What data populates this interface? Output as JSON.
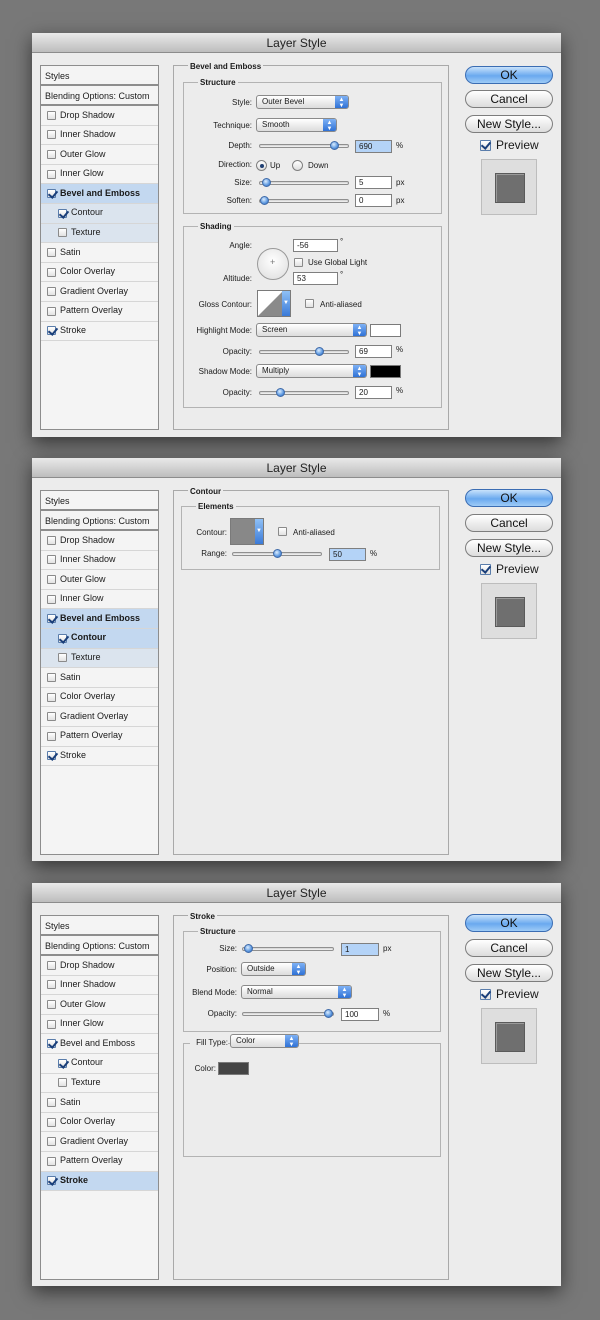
{
  "dialogs": [
    {
      "title": "Layer Style",
      "styles_header": "Styles",
      "blending": "Blending Options: Custom",
      "items": [
        {
          "label": "Drop Shadow",
          "checked": false
        },
        {
          "label": "Inner Shadow",
          "checked": false
        },
        {
          "label": "Outer Glow",
          "checked": false
        },
        {
          "label": "Inner Glow",
          "checked": false
        },
        {
          "label": "Bevel and Emboss",
          "checked": true
        },
        {
          "label": "Contour",
          "checked": true
        },
        {
          "label": "Texture",
          "checked": false
        },
        {
          "label": "Satin",
          "checked": false
        },
        {
          "label": "Color Overlay",
          "checked": false
        },
        {
          "label": "Gradient Overlay",
          "checked": false
        },
        {
          "label": "Pattern Overlay",
          "checked": false
        },
        {
          "label": "Stroke",
          "checked": true
        }
      ],
      "panel_title": "Bevel and Emboss",
      "structure": {
        "title": "Structure",
        "style_label": "Style:",
        "style_value": "Outer Bevel",
        "technique_label": "Technique:",
        "technique_value": "Smooth",
        "depth_label": "Depth:",
        "depth_value": "690",
        "depth_unit": "%",
        "depth_level": 0.88,
        "direction_label": "Direction:",
        "up_label": "Up",
        "down_label": "Down",
        "size_label": "Size:",
        "size_value": "5",
        "size_unit": "px",
        "size_level": 0.03,
        "soften_label": "Soften:",
        "soften_value": "0",
        "soften_unit": "px",
        "soften_level": 0.0
      },
      "shading": {
        "title": "Shading",
        "angle_label": "Angle:",
        "angle_value": "-56",
        "angle_unit": "°",
        "global_light_label": "Use Global Light",
        "altitude_label": "Altitude:",
        "altitude_value": "53",
        "altitude_unit": "°",
        "gloss_label": "Gloss Contour:",
        "anti_aliased_label": "Anti-aliased",
        "highlight_mode_label": "Highlight Mode:",
        "highlight_mode_value": "Screen",
        "highlight_color": "#ffffff",
        "opacity1_label": "Opacity:",
        "opacity1_value": "69",
        "opacity1_unit": "%",
        "opacity1_level": 0.69,
        "shadow_mode_label": "Shadow Mode:",
        "shadow_mode_value": "Multiply",
        "shadow_color": "#000000",
        "opacity2_label": "Opacity:",
        "opacity2_value": "20",
        "opacity2_unit": "%",
        "opacity2_level": 0.2
      },
      "buttons": {
        "ok": "OK",
        "cancel": "Cancel",
        "new_style": "New Style...",
        "preview": "Preview"
      }
    },
    {
      "title": "Layer Style",
      "styles_header": "Styles",
      "blending": "Blending Options: Custom",
      "items": [
        {
          "label": "Drop Shadow",
          "checked": false
        },
        {
          "label": "Inner Shadow",
          "checked": false
        },
        {
          "label": "Outer Glow",
          "checked": false
        },
        {
          "label": "Inner Glow",
          "checked": false
        },
        {
          "label": "Bevel and Emboss",
          "checked": true
        },
        {
          "label": "Contour",
          "checked": true
        },
        {
          "label": "Texture",
          "checked": false
        },
        {
          "label": "Satin",
          "checked": false
        },
        {
          "label": "Color Overlay",
          "checked": false
        },
        {
          "label": "Gradient Overlay",
          "checked": false
        },
        {
          "label": "Pattern Overlay",
          "checked": false
        },
        {
          "label": "Stroke",
          "checked": true
        }
      ],
      "panel_title": "Contour",
      "elements": {
        "title": "Elements",
        "contour_label": "Contour:",
        "anti_aliased_label": "Anti-aliased",
        "range_label": "Range:",
        "range_value": "50",
        "range_unit": "%",
        "range_level": 0.5
      },
      "buttons": {
        "ok": "OK",
        "cancel": "Cancel",
        "new_style": "New Style...",
        "preview": "Preview"
      }
    },
    {
      "title": "Layer Style",
      "styles_header": "Styles",
      "blending": "Blending Options: Custom",
      "items": [
        {
          "label": "Drop Shadow",
          "checked": false
        },
        {
          "label": "Inner Shadow",
          "checked": false
        },
        {
          "label": "Outer Glow",
          "checked": false
        },
        {
          "label": "Inner Glow",
          "checked": false
        },
        {
          "label": "Bevel and Emboss",
          "checked": true
        },
        {
          "label": "Contour",
          "checked": true
        },
        {
          "label": "Texture",
          "checked": false
        },
        {
          "label": "Satin",
          "checked": false
        },
        {
          "label": "Color Overlay",
          "checked": false
        },
        {
          "label": "Gradient Overlay",
          "checked": false
        },
        {
          "label": "Pattern Overlay",
          "checked": false
        },
        {
          "label": "Stroke",
          "checked": true
        }
      ],
      "panel_title": "Stroke",
      "structure": {
        "title": "Structure",
        "size_label": "Size:",
        "size_value": "1",
        "size_unit": "px",
        "size_level": 0.01,
        "position_label": "Position:",
        "position_value": "Outside",
        "blend_label": "Blend Mode:",
        "blend_value": "Normal",
        "opacity_label": "Opacity:",
        "opacity_value": "100",
        "opacity_unit": "%",
        "opacity_level": 1.0
      },
      "fill": {
        "fill_type_label": "Fill Type:",
        "fill_type_value": "Color",
        "color_label": "Color:",
        "color": "#444444"
      },
      "buttons": {
        "ok": "OK",
        "cancel": "Cancel",
        "new_style": "New Style...",
        "preview": "Preview"
      }
    }
  ]
}
